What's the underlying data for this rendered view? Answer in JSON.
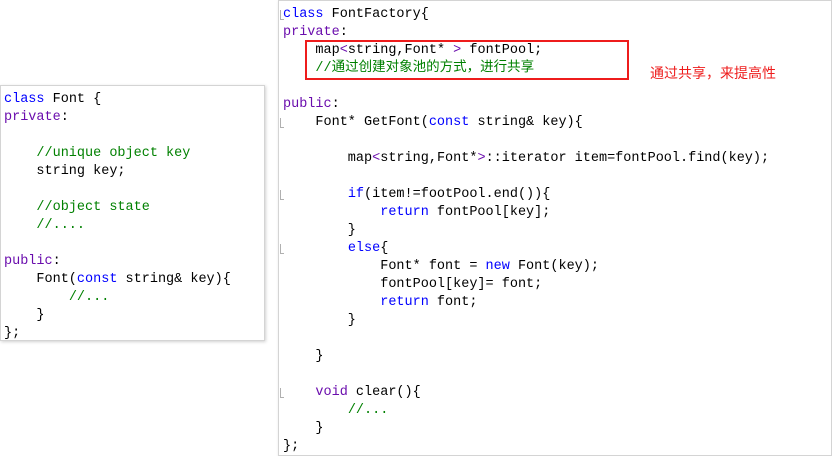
{
  "left_code": {
    "lines": [
      [
        [
          "class",
          "kw"
        ],
        [
          " Font {",
          ""
        ]
      ],
      [
        [
          "private",
          "ty"
        ],
        [
          ":",
          ""
        ]
      ],
      [],
      [
        [
          "    ",
          ""
        ],
        [
          "//unique object key",
          "cm"
        ]
      ],
      [
        [
          "    string key;",
          ""
        ]
      ],
      [],
      [
        [
          "    ",
          ""
        ],
        [
          "//object state",
          "cm"
        ]
      ],
      [
        [
          "    ",
          ""
        ],
        [
          "//....",
          "cm"
        ]
      ],
      [],
      [
        [
          "public",
          "ty"
        ],
        [
          ":",
          ""
        ]
      ],
      [
        [
          "    Font(",
          ""
        ],
        [
          "const",
          "kw"
        ],
        [
          " string& key){",
          ""
        ]
      ],
      [
        [
          "        ",
          ""
        ],
        [
          "//...",
          "cm"
        ]
      ],
      [
        [
          "    }",
          ""
        ]
      ],
      [
        [
          "};",
          ""
        ]
      ]
    ]
  },
  "right_code": {
    "lines": [
      [
        [
          "class",
          "kw"
        ],
        [
          " FontFactory{",
          ""
        ]
      ],
      [
        [
          "private",
          "ty"
        ],
        [
          ":",
          ""
        ]
      ],
      [
        [
          "    map",
          ""
        ],
        [
          "<",
          "ty"
        ],
        [
          "string,Font* ",
          ""
        ],
        [
          ">",
          "ty"
        ],
        [
          " fontPool;",
          ""
        ]
      ],
      [
        [
          "    ",
          ""
        ],
        [
          "//通过创建对象池的方式，进行共享",
          "cm"
        ]
      ],
      [],
      [
        [
          "public",
          "ty"
        ],
        [
          ":",
          ""
        ]
      ],
      [
        [
          "    Font* GetFont(",
          ""
        ],
        [
          "const",
          "kw"
        ],
        [
          " string& key){",
          ""
        ]
      ],
      [],
      [
        [
          "        map",
          ""
        ],
        [
          "<",
          "ty"
        ],
        [
          "string,Font*",
          ""
        ],
        [
          ">",
          "ty"
        ],
        [
          "::iterator item=fontPool.find(key);",
          ""
        ]
      ],
      [],
      [
        [
          "        ",
          ""
        ],
        [
          "if",
          "kw"
        ],
        [
          "(item!=footPool.end()){",
          ""
        ]
      ],
      [
        [
          "            ",
          ""
        ],
        [
          "return",
          "kw"
        ],
        [
          " fontPool[key];",
          ""
        ]
      ],
      [
        [
          "        }",
          ""
        ]
      ],
      [
        [
          "        ",
          ""
        ],
        [
          "else",
          "kw"
        ],
        [
          "{",
          ""
        ]
      ],
      [
        [
          "            Font* font = ",
          ""
        ],
        [
          "new",
          "kw"
        ],
        [
          " Font(key);",
          ""
        ]
      ],
      [
        [
          "            fontPool[key]= font;",
          ""
        ]
      ],
      [
        [
          "            ",
          ""
        ],
        [
          "return",
          "kw"
        ],
        [
          " font;",
          ""
        ]
      ],
      [
        [
          "        }",
          ""
        ]
      ],
      [],
      [
        [
          "    }",
          ""
        ]
      ],
      [],
      [
        [
          "    ",
          ""
        ],
        [
          "void",
          "ty"
        ],
        [
          " clear(){",
          ""
        ]
      ],
      [
        [
          "        ",
          ""
        ],
        [
          "//...",
          "cm"
        ]
      ],
      [
        [
          "    }",
          ""
        ]
      ],
      [
        [
          "};",
          ""
        ]
      ]
    ]
  },
  "annotation": {
    "text": "通过共享，来提高性"
  },
  "colors": {
    "keyword": "#0000ff",
    "type_keyword": "#6a0dad",
    "comment": "#008000",
    "annotation": "#ee1c1c"
  }
}
